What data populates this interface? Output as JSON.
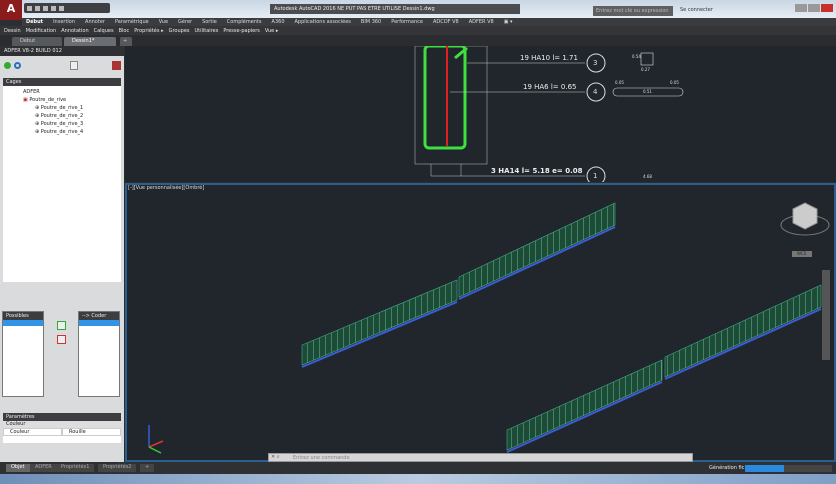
{
  "app": {
    "logo": "A",
    "title": "Autodesk AutoCAD 2016  NE PUT PAS ETRE UTILISE  Dessin1.dwg",
    "search_placeholder": "Entrez mot clé ou expression",
    "signin": "Se connecter"
  },
  "ribbon_tabs": [
    "Début",
    "Insertion",
    "Annoter",
    "Paramétrique",
    "Vue",
    "Gérer",
    "Sortie",
    "Compléments",
    "A360",
    "Applications associées",
    "BIM 360",
    "Performance",
    "ADCOF V8",
    "ADFER V8",
    "▣ ▾"
  ],
  "menus": [
    "Dessin",
    "Modification",
    "Annotation",
    "Calques",
    "Bloc",
    "Propriétés ▸",
    "Groupes",
    "Utilitaires",
    "Presse-papiers",
    "Vue ▸"
  ],
  "doc_tabs": [
    "Début",
    "Dessin1*",
    "+"
  ],
  "left_panel": {
    "title": "ADFER V8-2 BUILD 012",
    "cages_header": "Cages",
    "tree": [
      {
        "label": "ADFER",
        "level": 0
      },
      {
        "label": "Poutre_de_rive",
        "level": 1
      },
      {
        "label": "Poutre_de_rive_1",
        "level": 2
      },
      {
        "label": "Poutre_de_rive_2",
        "level": 2
      },
      {
        "label": "Poutre_de_rive_3",
        "level": 2
      },
      {
        "label": "Poutre_de_rive_4",
        "level": 2
      }
    ],
    "possibles": "Possibles",
    "coder": "--> Coder",
    "parametres": "Paramètres",
    "group": "Couleur",
    "param_name": "Couleur",
    "param_value": "Rouille"
  },
  "drawing": {
    "labels": [
      "19 HA10  l= 1.71",
      "19 HA6  l= 0.65",
      "3 HA14  l= 5.18  e= 0.08"
    ],
    "marks": [
      "3",
      "4",
      "1"
    ],
    "dims": [
      "0.27",
      "0.54",
      "0.05",
      "0.51",
      "0.05",
      "4.68"
    ]
  },
  "viewport": {
    "label": "[-][Vue personnalisée][Ombré]",
    "viewcube_label": "WCS"
  },
  "command": {
    "placeholder": "Entrez une commande"
  },
  "status": {
    "tabs": [
      "Objet",
      "ADFER",
      "Propriétés1",
      "Propriétés2",
      "+"
    ],
    "generation_label": "Génération fic",
    "generation_progress": 45
  },
  "colors": {
    "accent": "#2a8ae0",
    "rebar_green": "#3ee03e",
    "rebar_red": "#e02020",
    "viewport_bg": "#21262c"
  }
}
